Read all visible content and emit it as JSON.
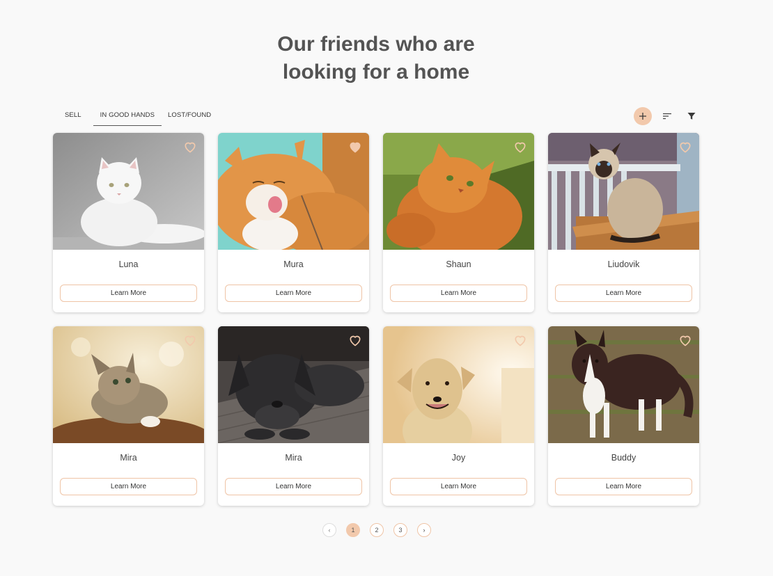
{
  "heading": {
    "line1": "Our friends who are",
    "line2": "looking for a home"
  },
  "tabs": [
    {
      "label": "Sell",
      "active": false
    },
    {
      "label": "In good hands",
      "active": true
    },
    {
      "label": "Lost/Found",
      "active": false
    }
  ],
  "toolbar": {
    "add_icon": "plus-icon",
    "sort_icon": "sort-icon",
    "filter_icon": "filter-icon"
  },
  "cards": [
    {
      "name": "Luna",
      "button": "Learn More",
      "liked": false,
      "photo": "white-cat"
    },
    {
      "name": "Mura",
      "button": "Learn More",
      "liked": true,
      "photo": "ginger-cat-licking"
    },
    {
      "name": "Shaun",
      "button": "Learn More",
      "liked": false,
      "photo": "orange-persian-cat"
    },
    {
      "name": "Liudovik",
      "button": "Learn More",
      "liked": false,
      "photo": "siamese-cat"
    },
    {
      "name": "Mira",
      "button": "Learn More",
      "liked": false,
      "photo": "tabby-kitten"
    },
    {
      "name": "Mira",
      "button": "Learn More",
      "liked": false,
      "photo": "black-puppy"
    },
    {
      "name": "Joy",
      "button": "Learn More",
      "liked": false,
      "photo": "yellow-dog"
    },
    {
      "name": "Buddy",
      "button": "Learn More",
      "liked": false,
      "photo": "border-collie"
    }
  ],
  "pagination": {
    "prev": "‹",
    "pages": [
      "1",
      "2",
      "3"
    ],
    "current": "1",
    "next": "›"
  },
  "colors": {
    "accent": "#f2c9ac",
    "accent_border": "#efc4a6",
    "background": "#f9f9f9",
    "heading": "#545454"
  }
}
